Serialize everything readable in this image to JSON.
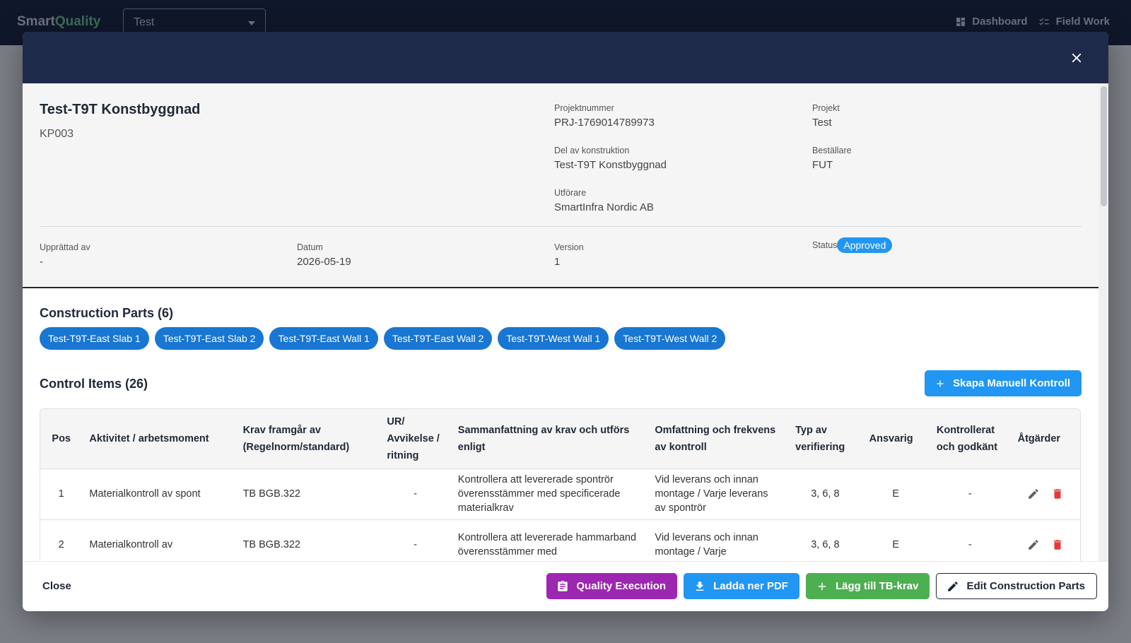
{
  "appbar": {
    "brand_part1": "Smart",
    "brand_part2": "Quality",
    "project_select": "Test",
    "nav": [
      {
        "label": "Dashboard",
        "icon": "dashboard-icon"
      },
      {
        "label": "Field Work",
        "icon": "checklist-icon"
      }
    ]
  },
  "document": {
    "title": "Test-T9T Konstbyggnad",
    "code": "KP003",
    "fields": {
      "projektnummer": {
        "label": "Projektnummer",
        "value": "PRJ-1769014789973"
      },
      "projekt": {
        "label": "Projekt",
        "value": "Test"
      },
      "del": {
        "label": "Del av konstruktion",
        "value": "Test-T9T Konstbyggnad"
      },
      "bestallare": {
        "label": "Beställare",
        "value": "FUT"
      },
      "utforare": {
        "label": "Utförare",
        "value": "SmartInfra Nordic AB"
      },
      "upprattad": {
        "label": "Upprättad av",
        "value": "-"
      },
      "datum": {
        "label": "Datum",
        "value": "2026-05-19"
      },
      "version": {
        "label": "Version",
        "value": "1"
      },
      "status": {
        "label": "Status",
        "value": "Approved"
      }
    }
  },
  "construction_parts": {
    "title": "Construction Parts (6)",
    "items": [
      "Test-T9T-East Slab 1",
      "Test-T9T-East Slab 2",
      "Test-T9T-East Wall 1",
      "Test-T9T-East Wall 2",
      "Test-T9T-West Wall 1",
      "Test-T9T-West Wall 2"
    ]
  },
  "control_items": {
    "title": "Control Items (26)",
    "add_button": "Skapa Manuell Kontroll",
    "headers": {
      "pos": "Pos",
      "aktivitet": "Aktivitet / arbetsmoment",
      "krav": "Krav framgår av (Regelnorm/standard)",
      "ur": "UR/ Avvikelse / ritning",
      "sammanfattning": "Sammanfattning av krav och utförs enligt",
      "omfattning": "Omfattning och frekvens av kontroll",
      "typ": "Typ av verifiering",
      "ansvarig": "Ansvarig",
      "kontrollerat": "Kontrollerat och godkänt",
      "atgarder": "Åtgärder"
    },
    "rows": [
      {
        "pos": "1",
        "aktivitet": "Materialkontroll av spont",
        "krav": "TB BGB.322",
        "ur": "-",
        "sammanfattning": "Kontrollera att levererade spontrör överensstämmer med specificerade materialkrav",
        "omfattning": "Vid leverans och innan montage / Varje leverans av spontrör",
        "typ": "3, 6, 8",
        "ansvarig": "E",
        "kontrollerat": "-"
      },
      {
        "pos": "2",
        "aktivitet": "Materialkontroll av",
        "krav": "TB BGB.322",
        "ur": "-",
        "sammanfattning": "Kontrollera att levererade hammarband överensstämmer med",
        "omfattning": "Vid leverans och innan montage / Varje",
        "typ": "3, 6, 8",
        "ansvarig": "E",
        "kontrollerat": "-"
      }
    ]
  },
  "footer": {
    "close": "Close",
    "quality_execution": "Quality Execution",
    "download_pdf": "Ladda ner PDF",
    "add_tb": "Lägg till TB-krav",
    "edit_parts": "Edit Construction Parts"
  },
  "colors": {
    "header_bg": "#1e2a4a",
    "chip": "#1976d2",
    "primary": "#2196f3",
    "purple": "#9c27b0",
    "green": "#4caf50",
    "delete": "#e53935"
  }
}
